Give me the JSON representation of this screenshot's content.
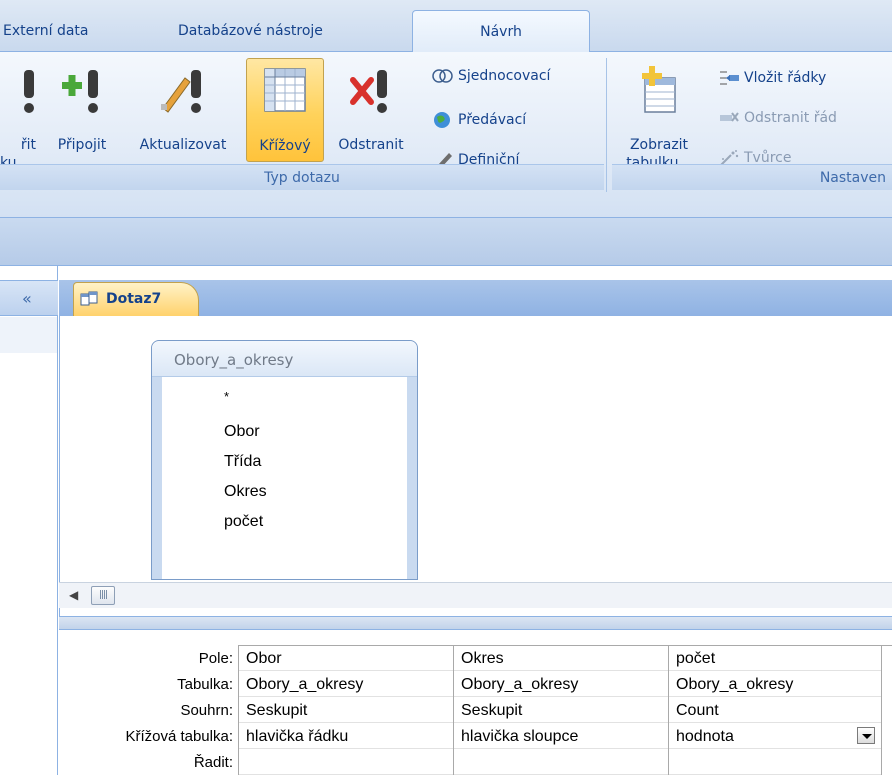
{
  "tabs": {
    "external_data": "Externí data",
    "db_tools": "Databázové nástroje",
    "design": "Návrh"
  },
  "ribbon": {
    "query_type_group": "Typ dotazu",
    "setup_group": "Nastaven",
    "buttons": {
      "make_table_line1": "řit",
      "make_table_line2": "ku",
      "append": "Připojit",
      "update": "Aktualizovat",
      "crosstab": "Křížový",
      "delete": "Odstranit",
      "union": "Sjednocovací",
      "pass_through": "Předávací",
      "data_definition": "Definiční",
      "show_table_line1": "Zobrazit",
      "show_table_line2": "tabulku...",
      "insert_rows": "Vložit řádky",
      "delete_rows": "Odstranit řád",
      "builder": "Tvůrce"
    }
  },
  "nav": {
    "collapse_glyph": "«"
  },
  "document": {
    "tab_title": "Dotaz7"
  },
  "table_box": {
    "title": "Obory_a_okresy",
    "fields": [
      "*",
      "Obor",
      "Třída",
      "Okres",
      "počet"
    ]
  },
  "grid": {
    "row_labels": [
      "Pole:",
      "Tabulka:",
      "Souhrn:",
      "Křížová tabulka:",
      "Řadit:"
    ],
    "columns": [
      {
        "field": "Obor",
        "table": "Obory_a_okresy",
        "total": "Seskupit",
        "crosstab": "hlavička řádku"
      },
      {
        "field": "Okres",
        "table": "Obory_a_okresy",
        "total": "Seskupit",
        "crosstab": "hlavička sloupce"
      },
      {
        "field": "počet",
        "table": "Obory_a_okresy",
        "total": "Count",
        "crosstab": "hodnota"
      }
    ]
  },
  "colors": {
    "ribbon_text": "#15428b",
    "active_button": "#ffd25a",
    "ribbon_border": "#8db2e3"
  }
}
